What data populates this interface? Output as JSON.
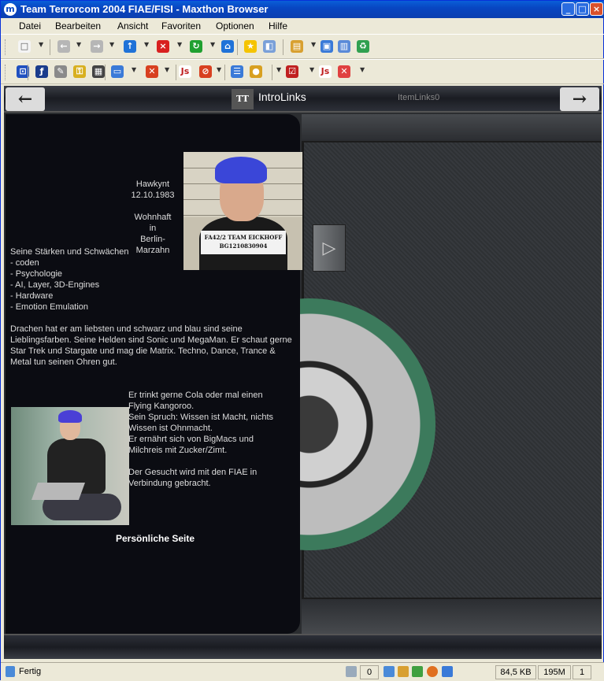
{
  "window": {
    "app_icon": "m",
    "title": "Team Terrorcom 2004 FIAE/FISI - Maxthon Browser",
    "minimize": "_",
    "maximize": "□",
    "close": "×"
  },
  "menu": [
    "Datei",
    "Bearbeiten",
    "Ansicht",
    "Favoriten",
    "Optionen",
    "Hilfe"
  ],
  "toolbar1": [
    {
      "name": "new-page-icon",
      "glyph": "□",
      "color": "#f4f4f4",
      "fg": "#555"
    },
    {
      "name": "back-icon",
      "glyph": "←",
      "color": "#b6b6b6"
    },
    {
      "name": "forward-icon",
      "glyph": "→",
      "color": "#b6b6b6"
    },
    {
      "name": "up-icon",
      "glyph": "↑",
      "color": "#1f72d8"
    },
    {
      "name": "stop-icon",
      "glyph": "×",
      "color": "#d82020"
    },
    {
      "name": "refresh-icon",
      "glyph": "↻",
      "color": "#20a030"
    },
    {
      "name": "home-icon",
      "glyph": "⌂",
      "color": "#1f72d8"
    },
    {
      "name": "favorites-star-icon",
      "glyph": "★",
      "color": "#f5c400"
    },
    {
      "name": "history-icon",
      "glyph": "◧",
      "color": "#7aa0d8"
    },
    {
      "name": "group-icon",
      "glyph": "▤",
      "color": "#d8a030"
    },
    {
      "name": "fullscreen-icon",
      "glyph": "▣",
      "color": "#3a7ad8"
    },
    {
      "name": "split-view-icon",
      "glyph": "▥",
      "color": "#5a8ad8"
    },
    {
      "name": "recycle-icon",
      "glyph": "♻",
      "color": "#30a050"
    }
  ],
  "toolbar2": [
    {
      "name": "popup-blocker-icon",
      "glyph": "⊡",
      "color": "#2050c0"
    },
    {
      "name": "flash-icon",
      "glyph": "ƒ",
      "color": "#1a3c8c"
    },
    {
      "name": "wrench-icon",
      "glyph": "✎",
      "color": "#8a8a8a"
    },
    {
      "name": "key-icon",
      "glyph": "⚿",
      "color": "#d8b020"
    },
    {
      "name": "notepad-icon",
      "glyph": "▦",
      "color": "#444"
    },
    {
      "name": "window-icon",
      "glyph": "▭",
      "color": "#3a7ad8"
    },
    {
      "name": "block-ads-icon",
      "glyph": "✕",
      "color": "#d84020"
    },
    {
      "name": "javascript-icon",
      "glyph": "Js",
      "color": "#ffffff",
      "fg": "#c02020"
    },
    {
      "name": "no-popups-icon",
      "glyph": "⊘",
      "color": "#d84020"
    },
    {
      "name": "list-icon",
      "glyph": "☰",
      "color": "#3a7ad8"
    },
    {
      "name": "activex-icon",
      "glyph": "●",
      "color": "#d8a020"
    },
    {
      "name": "checkbox-icon",
      "glyph": "☑",
      "color": "#c02020"
    },
    {
      "name": "javascript-off-icon",
      "glyph": "Js",
      "color": "#ffffff",
      "fg": "#c02020"
    },
    {
      "name": "close-all-icon",
      "glyph": "✕",
      "color": "#e04040"
    }
  ],
  "page": {
    "tt_logo": "TT",
    "intro_title": "IntroLinks",
    "item_links": "ItemLinks0",
    "arrow_left": "←",
    "arrow_right": "→",
    "sign_line1": "FA42/2 TEAM EICKHOFF",
    "sign_line2": "BG1210830904",
    "profile_lines": [
      "Hawkynt",
      "12.10.1983",
      "",
      "Wohnhaft",
      "in",
      "Berlin-",
      "Marzahn"
    ],
    "strengths_lines": [
      "Seine Stärken und Schwächen",
      "- coden",
      "- Psychologie",
      "- AI, Layer, 3D-Engines",
      "- Hardware",
      "- Emotion Emulation"
    ],
    "paragraph": "Drachen hat er am liebsten und schwarz und blau sind seine Lieblingsfarben. Seine Helden sind Sonic und MegaMan. Er schaut gerne Star Trek und Stargate und mag die Matrix. Techno, Dance, Trance & Metal tun seinen Ohren gut.",
    "side_lines": [
      "Er trinkt gerne Cola oder mal einen",
      "Flying Kangoroo.",
      "Sein Spruch: Wissen ist Macht, nichts",
      "Wissen ist Ohnmacht.",
      "Er ernährt sich von BigMacs und",
      "Milchreis mit Zucker/Zimt.",
      "",
      "Der Gesucht wird mit den FIAE in",
      "Verbindung gebracht."
    ],
    "personal_link": "Persönliche Seite"
  },
  "status": {
    "text": "Fertig",
    "counter": "0",
    "size": "84,5 KB",
    "memory": "195M",
    "pages": "1"
  }
}
